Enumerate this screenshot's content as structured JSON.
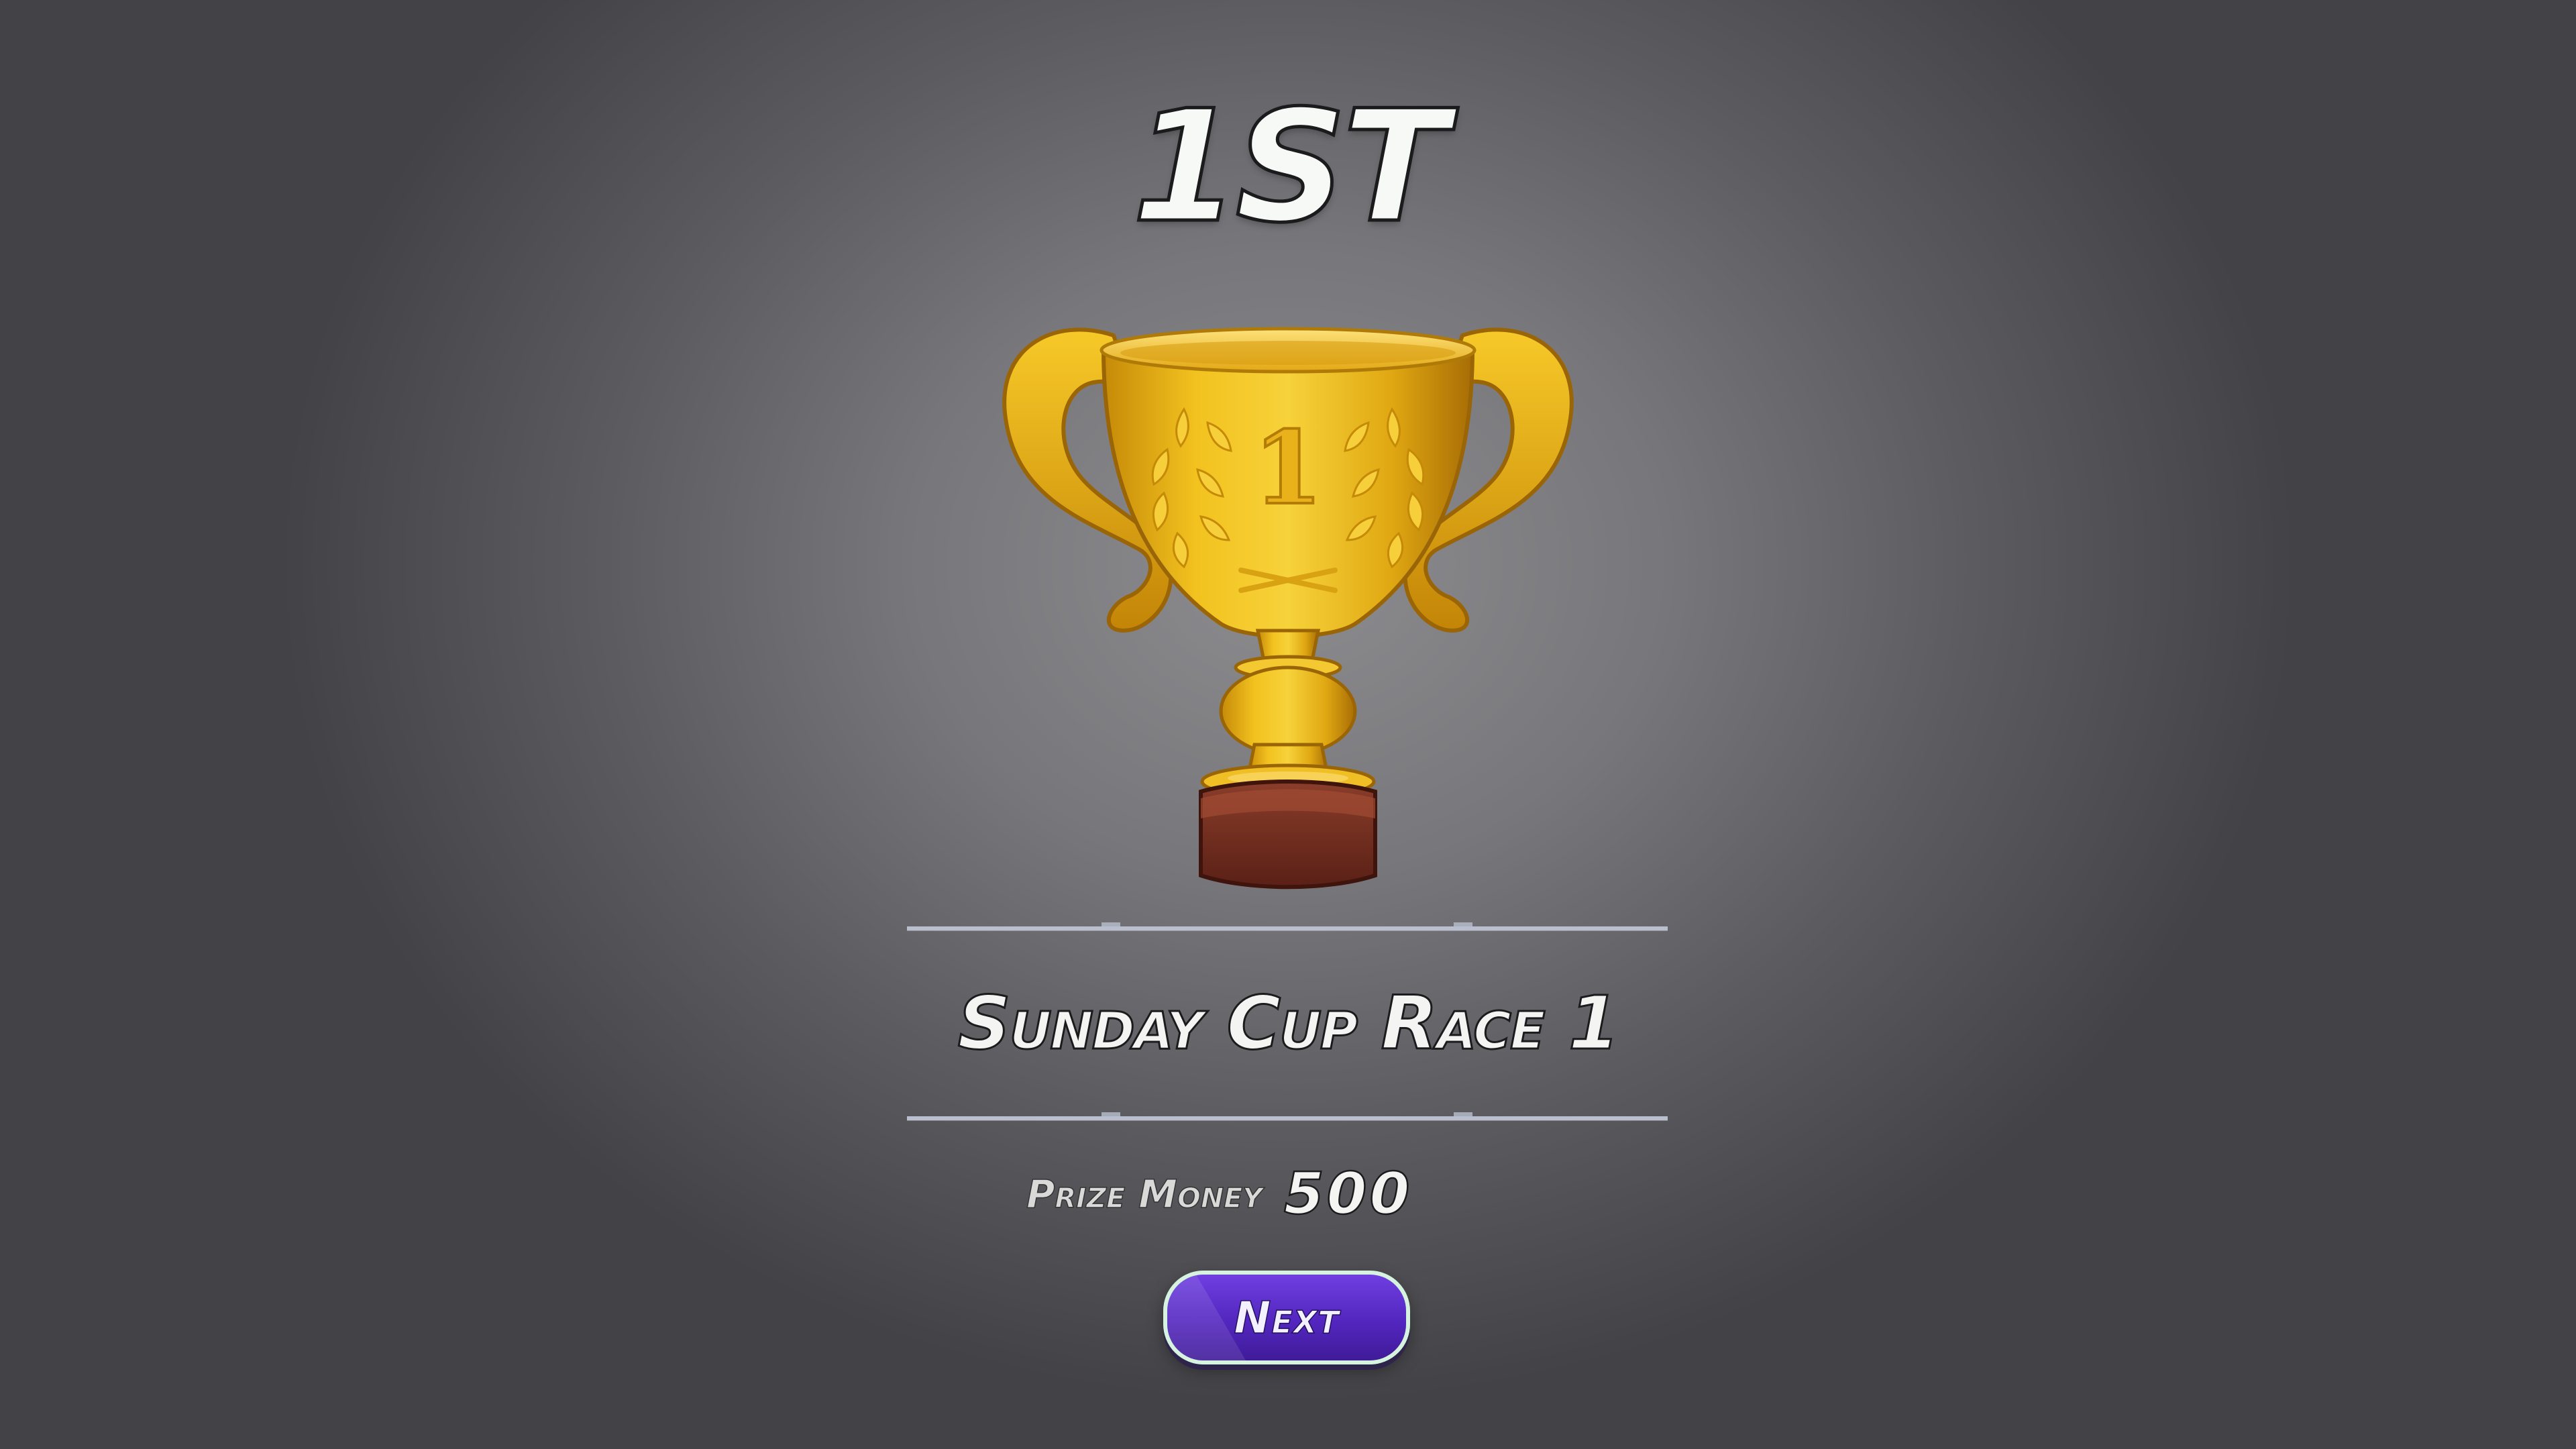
{
  "result": {
    "placement": "1ST",
    "trophy_icon": "gold-trophy-first-place",
    "trophy_emblem": "1"
  },
  "race": {
    "title": "Sunday Cup Race 1"
  },
  "prize": {
    "label": "Prize Money",
    "value": "500"
  },
  "actions": {
    "next_label": "Next"
  },
  "colors": {
    "background": "#7a7a7e",
    "button": "#5a2cc8",
    "button_border": "#d6f3df",
    "trophy_gold": "#e8b416",
    "trophy_base": "#6b2a1c",
    "divider": "#b9bfce"
  }
}
